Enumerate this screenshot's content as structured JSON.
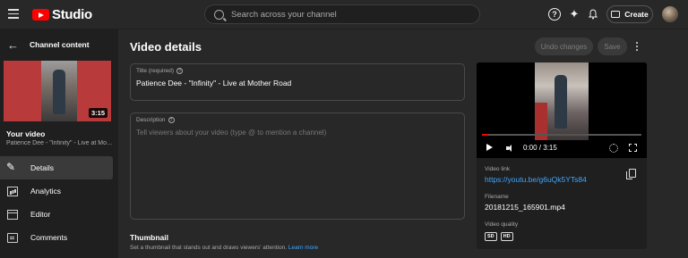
{
  "app": {
    "logo_text": "Studio",
    "brand_color": "#ff0000"
  },
  "search": {
    "placeholder": "Search across your channel"
  },
  "header": {
    "create_label": "Create"
  },
  "sidebar": {
    "back_label": "Channel content",
    "thumbnail_duration": "3:15",
    "your_video_label": "Your video",
    "your_video_title": "Patience Dee - \"Infinity\" - Live at Mother Road",
    "items": [
      {
        "label": "Details",
        "icon": "pencil-icon",
        "active": true
      },
      {
        "label": "Analytics",
        "icon": "analytics-icon"
      },
      {
        "label": "Editor",
        "icon": "editor-icon"
      },
      {
        "label": "Comments",
        "icon": "comments-icon"
      }
    ]
  },
  "main": {
    "title": "Video details",
    "undo_label": "Undo changes",
    "save_label": "Save",
    "title_field": {
      "label": "Title (required)",
      "value": "Patience Dee - \"Infinity\" - Live at Mother Road"
    },
    "description_field": {
      "label": "Description",
      "placeholder": "Tell viewers about your video (type @ to mention a channel)"
    },
    "thumbnail": {
      "heading": "Thumbnail",
      "subtext": "Set a thumbnail that stands out and draws viewers' attention.",
      "learn_more": "Learn more"
    }
  },
  "panel": {
    "player": {
      "time": "0:00 / 3:15",
      "progress": 0.04
    },
    "video_link_label": "Video link",
    "video_link": "https://youtu.be/g6uQk5YTs84",
    "filename_label": "Filename",
    "filename": "20181215_165901.mp4",
    "quality_label": "Video quality",
    "quality_badges": [
      "SD",
      "HD"
    ],
    "link_color": "#3ea6ff"
  }
}
